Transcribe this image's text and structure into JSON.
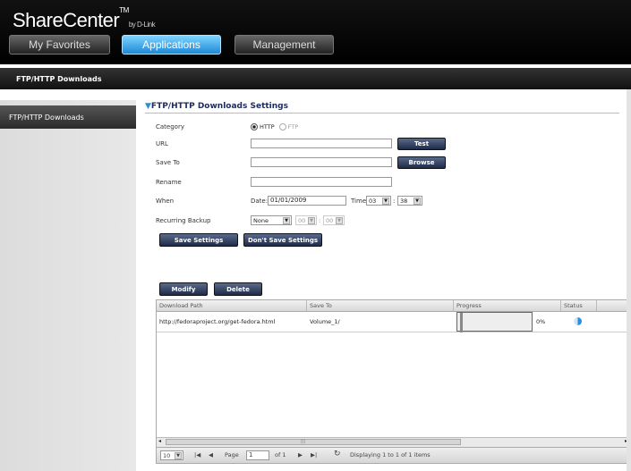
{
  "brand": {
    "name": "ShareCenter",
    "tm": "TM",
    "by": "by D-Link"
  },
  "nav": {
    "tabs": [
      "My Favorites",
      "Applications",
      "Management"
    ],
    "active": "Applications"
  },
  "subheader": {
    "title": "FTP/HTTP Downloads"
  },
  "sidebar": {
    "items": [
      {
        "label": "FTP/HTTP Downloads"
      }
    ]
  },
  "settings": {
    "title": "FTP/HTTP Downloads Settings",
    "category": {
      "label": "Category",
      "options": [
        "HTTP",
        "FTP"
      ],
      "selected": "HTTP"
    },
    "url": {
      "label": "URL",
      "value": ""
    },
    "save_to": {
      "label": "Save To",
      "value": ""
    },
    "rename": {
      "label": "Rename",
      "value": ""
    },
    "when": {
      "label": "When",
      "date_label": "Date:",
      "date_value": "01/01/2009",
      "time_label": "Time:",
      "hour": "03",
      "minute": "38"
    },
    "recurring": {
      "label": "Recurring Backup",
      "mode": "None",
      "hour": "00",
      "minute": "00"
    },
    "buttons": {
      "test": "Test",
      "browse": "Browse",
      "save": "Save Settings",
      "dont_save": "Don't Save Settings"
    }
  },
  "grid": {
    "buttons": {
      "modify": "Modify",
      "delete": "Delete"
    },
    "columns": [
      "Download Path",
      "Save To",
      "Progress",
      "Status"
    ],
    "rows": [
      {
        "path": "http://fedoraproject.org/get-fedora.html",
        "save_to": "Volume_1/",
        "progress_pct": 0,
        "progress_text": "0%"
      }
    ],
    "pager": {
      "per_page": "10",
      "page_label": "Page",
      "page": "1",
      "of_label": "of 1",
      "display": "Displaying 1 to 1 of 1 items"
    },
    "scroll_glyph": "|||"
  },
  "colors": {
    "accent": "#2a8fd8",
    "button": "#2b3656",
    "header_bg": "#000000"
  }
}
